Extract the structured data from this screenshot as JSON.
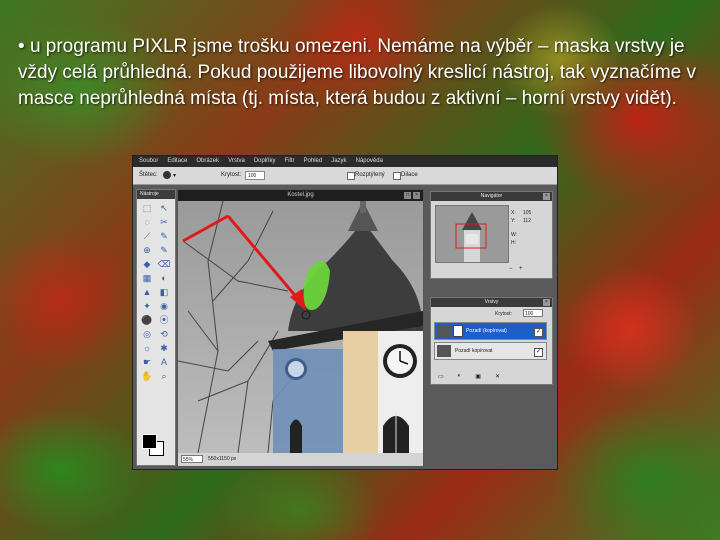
{
  "slide": {
    "bullet": "•",
    "text": "u programu PIXLR jsme trošku omezeni. Nemáme na výběr – maska vrstvy je vždy celá průhledná. Pokud použijeme libovolný kreslicí nástroj, tak vyznačíme v masce neprůhledná místa (tj. místa, která budou z aktivní – horní vrstvy vidět)."
  },
  "app": {
    "menu": [
      "Soubor",
      "Editace",
      "Obrázek",
      "Vrstva",
      "Doplňky",
      "Filtr",
      "Pohled",
      "Jazyk",
      "Nápověda"
    ],
    "options": {
      "brush_label": "Štětec:",
      "opacity_label": "Krytost:",
      "opacity_value": "100",
      "checkbox1_label": "Rozptýlený",
      "checkbox2_label": "Dilace"
    },
    "toolbox": {
      "title": "Nástroje",
      "tools": [
        "⬚",
        "↖",
        "◌",
        "✂",
        "⟋",
        "✎",
        "⊕",
        "✎",
        "◆",
        "⌫",
        "▦",
        "◐",
        "▲",
        "◧",
        "✦",
        "◉",
        "⚫",
        "⦿",
        "◎",
        "⟲",
        "☼",
        "✱",
        "☛",
        "A",
        "✋",
        "⌕"
      ]
    },
    "canvas": {
      "title": "Kostel.jpg",
      "zoom": "55%",
      "dims": "550x1150 px"
    },
    "navigator": {
      "title": "Navigátor",
      "x_label": "X:",
      "x_value": "105",
      "y_label": "Y:",
      "y_value": "112",
      "w_label": "W:",
      "w_value": "",
      "h_label": "H:",
      "h_value": ""
    },
    "layers": {
      "title": "Vrstvy",
      "opacity_label": "Krytost:",
      "opacity_value": "100",
      "items": [
        {
          "name": "Pozadí (kopírovat)",
          "selected": true,
          "has_mask": true
        },
        {
          "name": "Pozadí kopírovat",
          "selected": false,
          "has_mask": false
        }
      ]
    },
    "colors": {
      "selection": "#1b5fc7",
      "mask_paint": "#6dd43a",
      "arrow": "#e01a1a"
    }
  }
}
